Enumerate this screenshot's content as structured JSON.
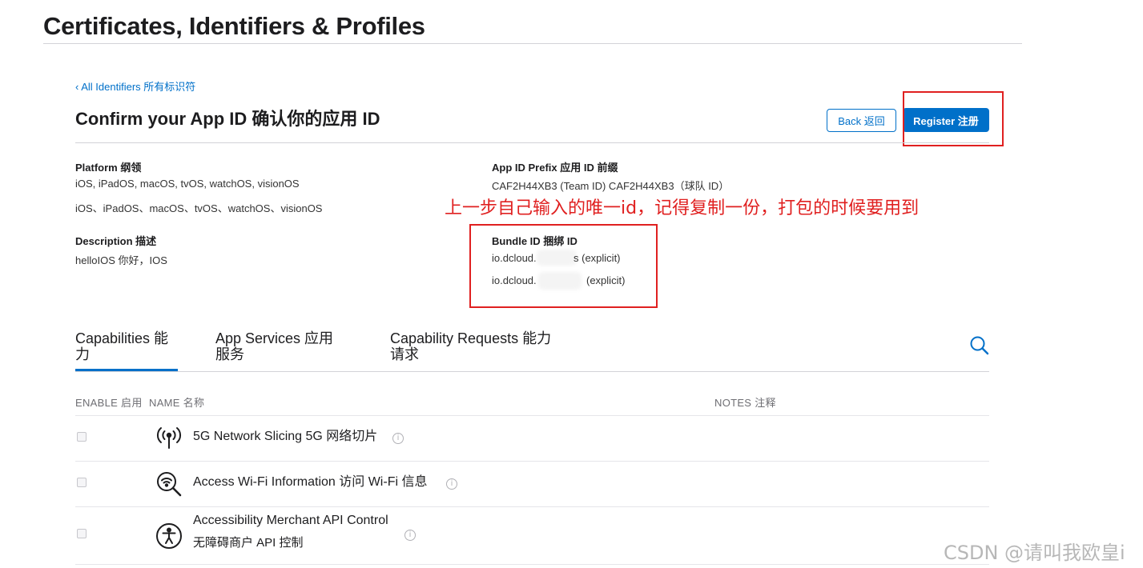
{
  "page_title": "Certificates, Identifiers & Profiles",
  "back_link": "‹ All Identifiers  所有标识符",
  "confirm_title": "Confirm your App ID  确认你的应用 ID",
  "buttons": {
    "back": "Back  返回",
    "register": "Register  注册"
  },
  "details": {
    "platform_label": "Platform  纲领",
    "platform_value_en": "iOS, iPadOS, macOS, tvOS, watchOS, visionOS",
    "platform_value_cn": "iOS、iPadOS、macOS、tvOS、watchOS、visionOS",
    "description_label": "Description  描述",
    "description_value": "helloIOS  你好，IOS",
    "prefix_label": "App ID Prefix  应用 ID 前缀",
    "prefix_value": "CAF2H44XB3 (Team ID)  CAF2H44XB3（球队 ID）",
    "bundle_label": "Bundle ID  捆绑 ID",
    "bundle_value_1_prefix": "io.dcloud.",
    "bundle_value_1_suffix": "s (explicit)",
    "bundle_value_2_prefix": "io.dcloud.",
    "bundle_value_2_suffix": "(explicit)"
  },
  "annotation": "上一步自己输入的唯一id，记得复制一份，打包的时候要用到",
  "tabs": [
    {
      "label_line1": "Capabilities  能",
      "label_line2": "力"
    },
    {
      "label_line1": "App Services  应用",
      "label_line2": "服务"
    },
    {
      "label_line1": "Capability Requests  能力",
      "label_line2": "请求"
    }
  ],
  "columns": {
    "enable": "ENABLE  启用",
    "name": "NAME  名称",
    "notes": "NOTES  注释"
  },
  "capabilities": [
    {
      "name": "5G Network Slicing  5G 网络切片",
      "icon": "antenna-icon"
    },
    {
      "name": "Access Wi-Fi Information  访问 Wi-Fi 信息",
      "icon": "wifi-search-icon"
    },
    {
      "name_line1": "Accessibility Merchant API Control",
      "name_line2": "无障碍商户 API 控制",
      "icon": "accessibility-icon"
    }
  ],
  "info_glyph": "i",
  "watermark": "CSDN @请叫我欧皇i",
  "colors": {
    "accent": "#0070c9",
    "annotation_red": "#e02020"
  }
}
